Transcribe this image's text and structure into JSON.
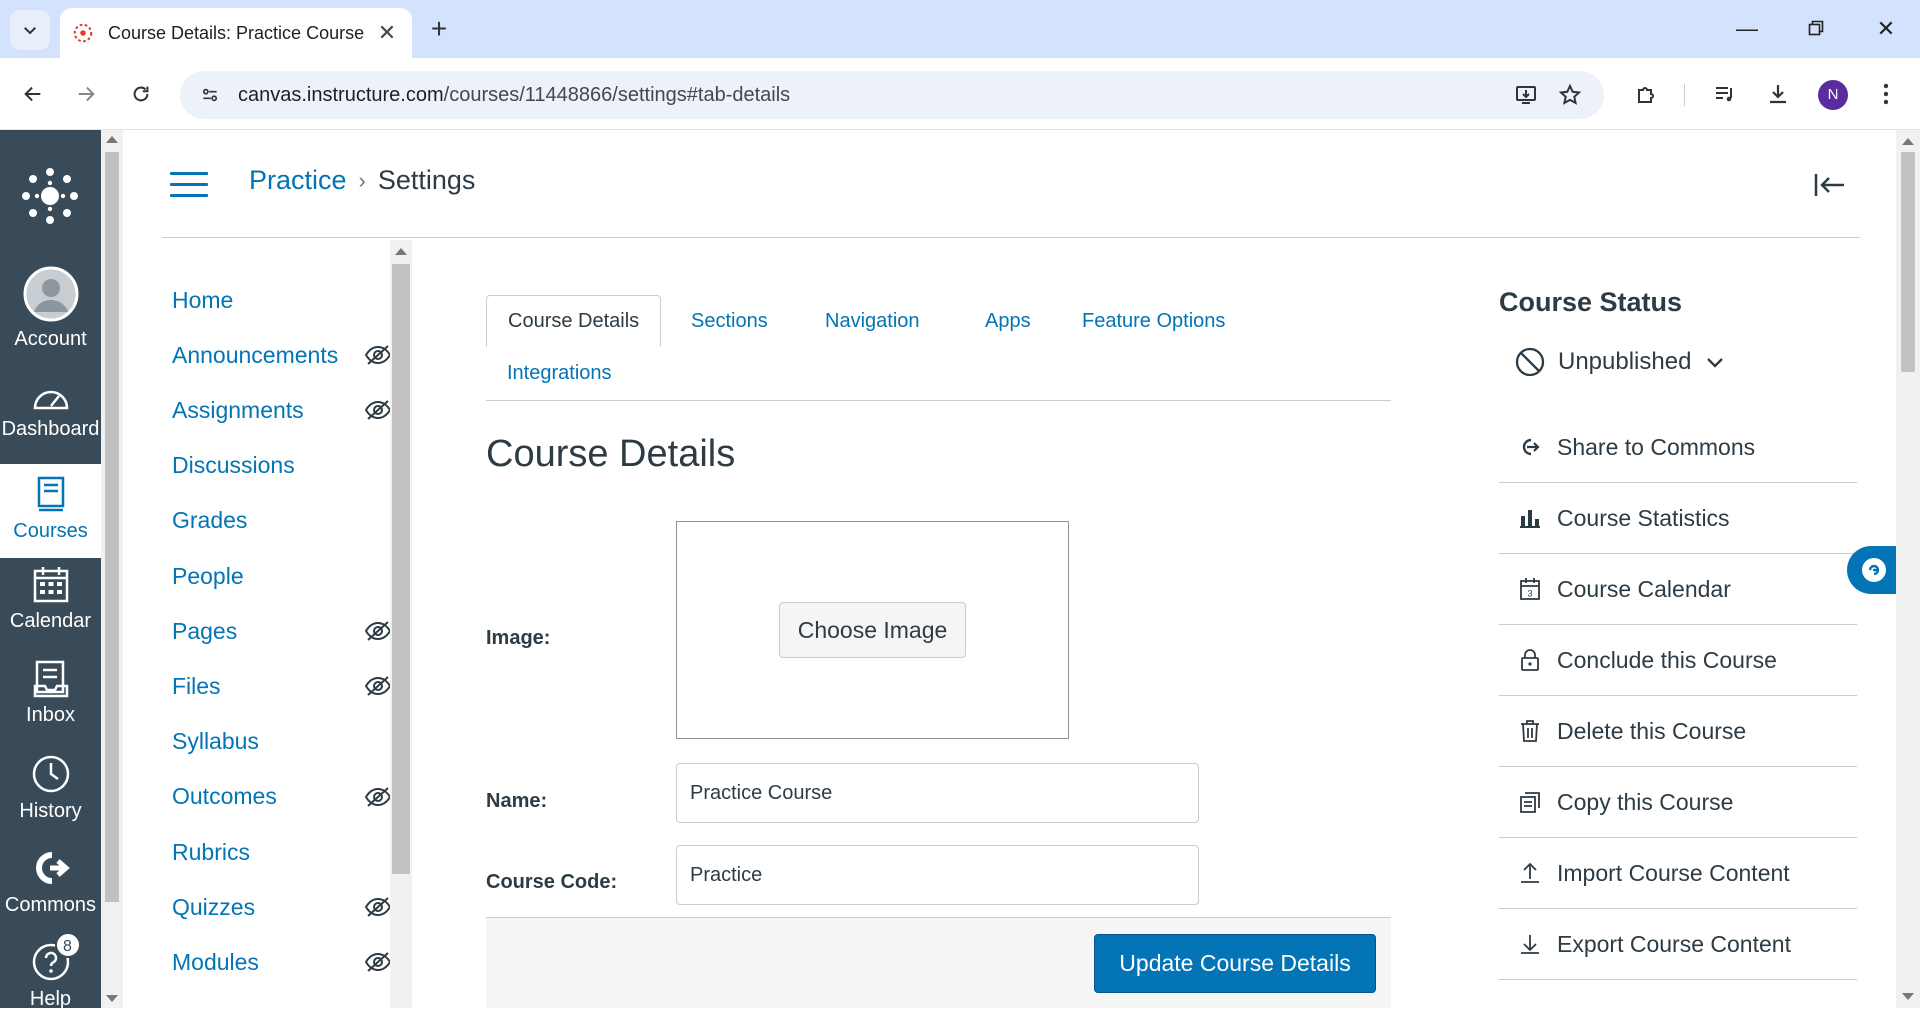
{
  "browser": {
    "tab_title": "Course Details: Practice Course",
    "url_host": "canvas.instructure.com",
    "url_path": "/courses/11448866/settings#tab-details",
    "profile_initial": "N"
  },
  "global_nav": {
    "items": [
      {
        "label": "Account",
        "icon": "user-avatar-icon"
      },
      {
        "label": "Dashboard",
        "icon": "speedometer-icon"
      },
      {
        "label": "Courses",
        "icon": "book-icon",
        "active": true
      },
      {
        "label": "Calendar",
        "icon": "calendar-icon"
      },
      {
        "label": "Inbox",
        "icon": "inbox-icon"
      },
      {
        "label": "History",
        "icon": "clock-icon"
      },
      {
        "label": "Commons",
        "icon": "commons-icon"
      },
      {
        "label": "Help",
        "icon": "help-icon",
        "badge": "8"
      }
    ]
  },
  "header": {
    "breadcrumb_link": "Practice",
    "breadcrumb_current": "Settings"
  },
  "course_nav": {
    "items": [
      {
        "label": "Home",
        "hidden": false
      },
      {
        "label": "Announcements",
        "hidden": true
      },
      {
        "label": "Assignments",
        "hidden": true
      },
      {
        "label": "Discussions",
        "hidden": false
      },
      {
        "label": "Grades",
        "hidden": false
      },
      {
        "label": "People",
        "hidden": false
      },
      {
        "label": "Pages",
        "hidden": true
      },
      {
        "label": "Files",
        "hidden": true
      },
      {
        "label": "Syllabus",
        "hidden": false
      },
      {
        "label": "Outcomes",
        "hidden": true
      },
      {
        "label": "Rubrics",
        "hidden": false
      },
      {
        "label": "Quizzes",
        "hidden": true
      },
      {
        "label": "Modules",
        "hidden": true
      }
    ]
  },
  "tabs": [
    {
      "label": "Course Details",
      "active": true
    },
    {
      "label": "Sections"
    },
    {
      "label": "Navigation"
    },
    {
      "label": "Apps"
    },
    {
      "label": "Feature Options"
    },
    {
      "label": "Integrations"
    }
  ],
  "details": {
    "title": "Course Details",
    "image_label": "Image:",
    "choose_image": "Choose Image",
    "name_label": "Name:",
    "name_value": "Practice Course",
    "code_label": "Course Code:",
    "code_value": "Practice",
    "update_button": "Update Course Details"
  },
  "sidebar": {
    "status_heading": "Course Status",
    "status_value": "Unpublished",
    "items": [
      {
        "label": "Share to Commons",
        "icon": "share-icon"
      },
      {
        "label": "Course Statistics",
        "icon": "bar-chart-icon"
      },
      {
        "label": "Course Calendar",
        "icon": "calendar-icon"
      },
      {
        "label": "Conclude this Course",
        "icon": "lock-icon"
      },
      {
        "label": "Delete this Course",
        "icon": "trash-icon"
      },
      {
        "label": "Copy this Course",
        "icon": "copy-icon"
      },
      {
        "label": "Import Course Content",
        "icon": "upload-icon"
      },
      {
        "label": "Export Course Content",
        "icon": "download-icon"
      }
    ]
  },
  "colors": {
    "accent": "#0374b5",
    "global_nav_bg": "#394b58",
    "text": "#2d3b45"
  }
}
